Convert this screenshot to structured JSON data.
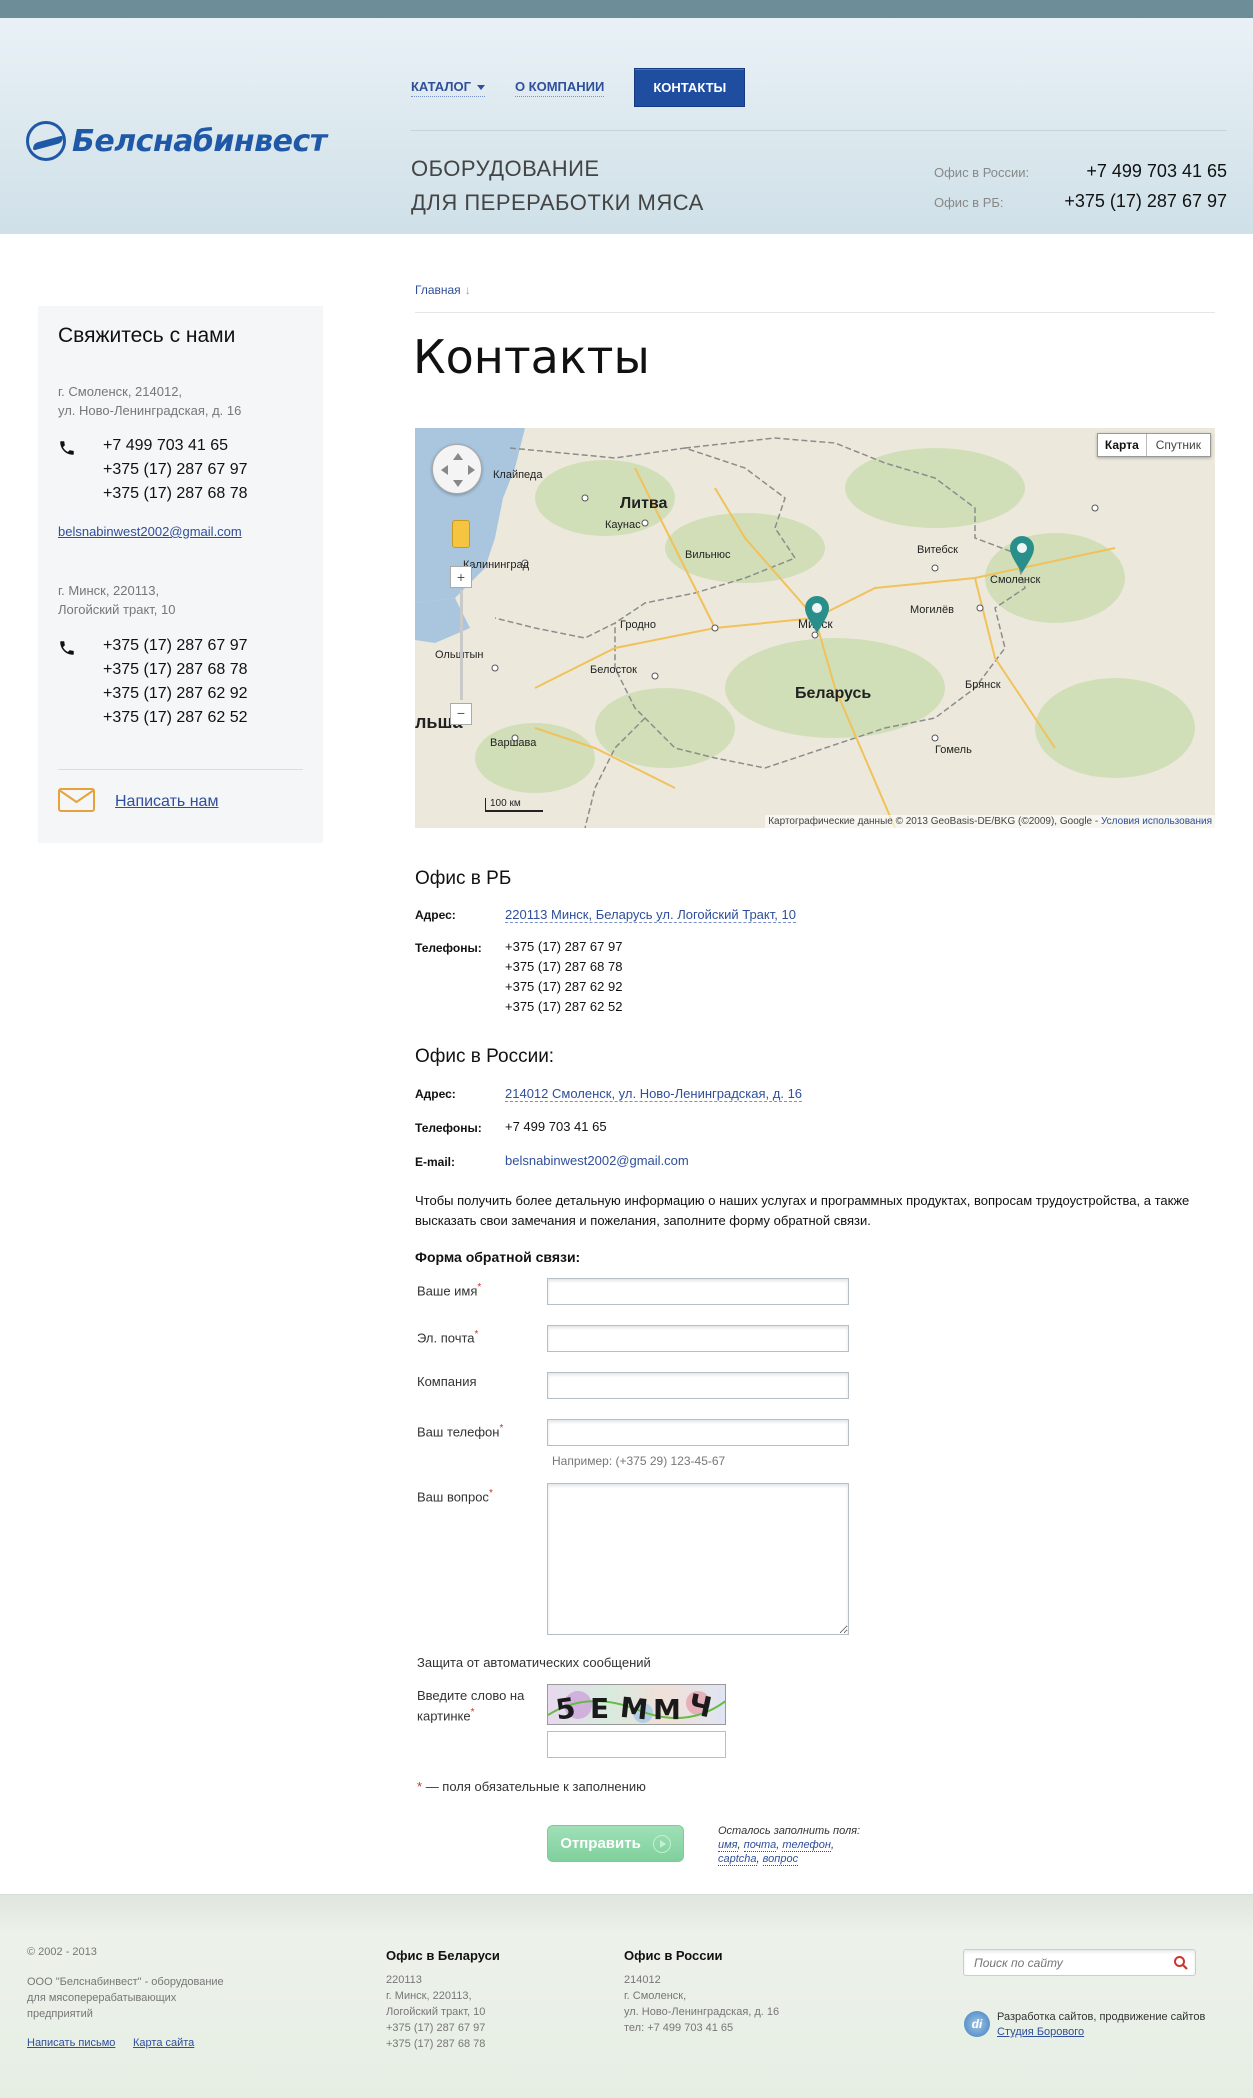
{
  "header": {
    "logo_text": "Белснабинвест",
    "nav": {
      "catalog": "КАТАЛОГ",
      "about": "О КОМПАНИИ",
      "contacts": "КОНТАКТЫ"
    },
    "tagline_line1": "ОБОРУДОВАНИЕ",
    "tagline_line2": "ДЛЯ ПЕРЕРАБОТКИ МЯСА",
    "phone_ru_label": "Офис в России:",
    "phone_ru": "+7 499 703 41 65",
    "phone_rb_label": "Офис в РБ:",
    "phone_rb": "+375 (17) 287 67 97"
  },
  "sidebar": {
    "title": "Свяжитесь с нами",
    "office1_addr_1": "г. Смоленск, 214012,",
    "office1_addr_2": "ул. Ново-Ленинградская, д. 16",
    "office1_phones": [
      "+7 499 703 41 65",
      "+375 (17) 287 67 97",
      "+375 (17) 287 68 78"
    ],
    "email": "belsnabinwest2002@gmail.com",
    "office2_addr_1": "г. Минск, 220113,",
    "office2_addr_2": "Логойский тракт, 10",
    "office2_phones": [
      "+375 (17) 287 67 97",
      "+375 (17) 287 68 78",
      "+375 (17) 287 62 92",
      "+375 (17) 287 62 52"
    ],
    "write_us": "Написать нам"
  },
  "main": {
    "breadcrumb": "Главная",
    "title": "Контакты",
    "map": {
      "btn_map": "Карта",
      "btn_satellite": "Спутник",
      "scale_km": "100 км",
      "attribution": "Картографические данные © 2013 GeoBasis-DE/BKG (©2009), Google -",
      "terms": "Условия использования"
    },
    "office_rb": {
      "title": "Офис в РБ",
      "address_label": "Адрес:",
      "address": "220113 Минск, Беларусь ул. Логойский Тракт, 10",
      "phones_label": "Телефоны:",
      "phones": [
        "+375 (17) 287 67 97",
        "+375 (17) 287 68 78",
        "+375 (17) 287 62 92",
        "+375 (17) 287 62 52"
      ]
    },
    "office_ru": {
      "title": "Офис в России:",
      "address_label": "Адрес:",
      "address": "214012 Смоленск, ул. Ново-Ленинградская, д. 16",
      "phones_label": "Телефоны:",
      "phone": "+7 499 703 41 65",
      "email_label": "E-mail:",
      "email": "belsnabinwest2002@gmail.com"
    },
    "info_text": "Чтобы получить более детальную информацию о наших услугах и программных продуктах, вопросам трудоустройства, а также высказать свои замечания и пожелания, заполните форму обратной связи.",
    "form": {
      "title": "Форма обратной связи:",
      "name_label": "Ваше имя",
      "email_label": "Эл. почта",
      "company_label": "Компания",
      "phone_label": "Ваш телефон",
      "phone_hint": "Например: (+375 29) 123-45-67",
      "question_label": "Ваш вопрос",
      "protection_label": "Защита от автоматических сообщений",
      "captcha_label_1": "Введите слово на",
      "captcha_label_2": "картинке",
      "required_star": "*",
      "required_note": "— поля обязательные к заполнению",
      "submit": "Отправить",
      "remaining_label": "Осталось заполнить поля:",
      "remaining_fields": [
        "имя",
        "почта",
        "телефон",
        "captcha",
        "вопрос"
      ]
    }
  },
  "footer": {
    "copyright": "© 2002 - 2013",
    "about_1": "ООО \"Белснабинвест\" - оборудование",
    "about_2": "для мясоперерабатывающих",
    "about_3": "предприятий",
    "link_letter": "Написать письмо",
    "link_sitemap": "Карта сайта",
    "by_title": "Офис в Беларуси",
    "by_lines": [
      "220113",
      "г. Минск, 220113,",
      "Логойский тракт, 10",
      "+375 (17) 287 67 97",
      "+375 (17) 287 68 78"
    ],
    "ru_title": "Офис в России",
    "ru_lines": [
      "214012",
      "г. Смоленск,",
      "ул. Ново-Ленинградская, д. 16",
      "тел: +7 499 703 41 65"
    ],
    "search_placeholder": "Поиск по сайту",
    "dev_text": "Разработка сайтов, продвижение сайтов",
    "dev_link": "Студия Борового"
  },
  "colors": {
    "brand_blue": "#1e58a6",
    "nav_active": "#1f4da0",
    "link": "#2f4f9a",
    "submit_green": "#8fd8aa",
    "marker": "#2a8f8a"
  }
}
